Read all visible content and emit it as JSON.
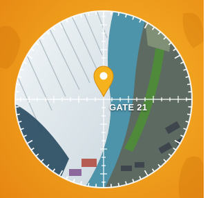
{
  "map": {
    "marker_label": "GATE 21"
  },
  "icons": {
    "marker": "location-pin-icon",
    "crosshair": "crosshair-icon"
  },
  "colors": {
    "background": "#f0a11e",
    "pin": "#f5b21c",
    "pin_dark": "#d48a0d",
    "ring": "#ffffff",
    "field": "#4d93aa",
    "roof": "#e6eef2"
  }
}
